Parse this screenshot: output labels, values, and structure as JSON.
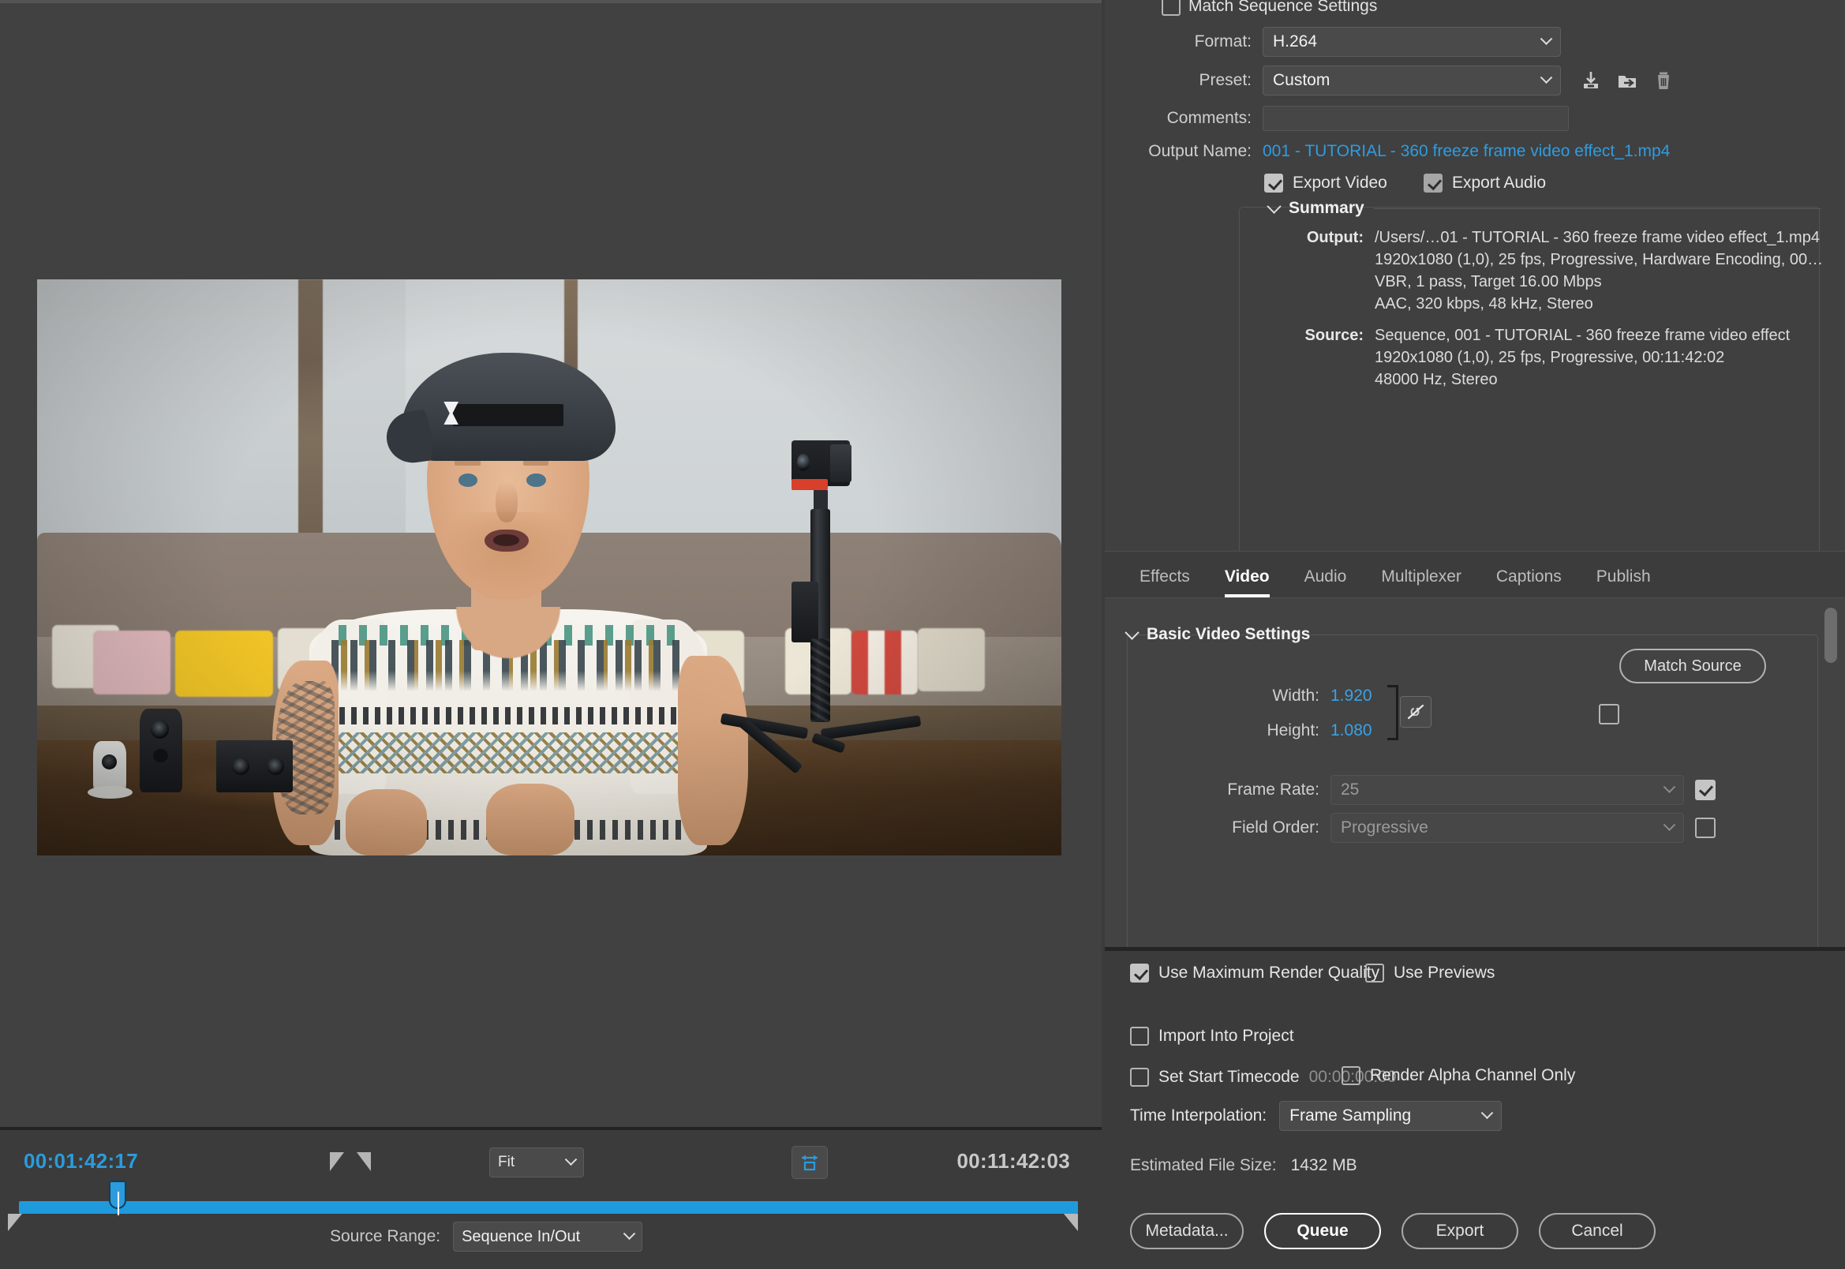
{
  "preview": {
    "current_timecode": "00:01:42:17",
    "duration_timecode": "00:11:42:03",
    "zoom_level": "Fit",
    "source_range_label": "Source Range:",
    "source_range_value": "Sequence In/Out"
  },
  "export_settings": {
    "match_sequence_settings": {
      "label": "Match Sequence Settings",
      "checked": false
    },
    "format": {
      "label": "Format:",
      "value": "H.264"
    },
    "preset": {
      "label": "Preset:",
      "value": "Custom"
    },
    "comments": {
      "label": "Comments:",
      "value": ""
    },
    "output_name": {
      "label": "Output Name:",
      "value": "001 - TUTORIAL - 360 freeze frame video effect_1.mp4"
    },
    "export_video": {
      "label": "Export Video",
      "checked": true
    },
    "export_audio": {
      "label": "Export Audio",
      "checked": true
    },
    "preset_icons": [
      "save-preset-icon",
      "import-preset-icon",
      "delete-preset-icon"
    ]
  },
  "summary": {
    "title": "Summary",
    "output_key": "Output:",
    "output_lines": [
      "/Users/…01 - TUTORIAL - 360 freeze frame video effect_1.mp4",
      "1920x1080 (1,0), 25 fps, Progressive, Hardware Encoding, 00…",
      "VBR, 1 pass, Target 16.00 Mbps",
      "AAC, 320 kbps, 48 kHz, Stereo"
    ],
    "source_key": "Source:",
    "source_lines": [
      "Sequence, 001 - TUTORIAL - 360 freeze frame video effect",
      "1920x1080 (1,0), 25 fps, Progressive, 00:11:42:02",
      "48000 Hz, Stereo"
    ]
  },
  "tabs": [
    {
      "label": "Effects",
      "active": false
    },
    {
      "label": "Video",
      "active": true
    },
    {
      "label": "Audio",
      "active": false
    },
    {
      "label": "Multiplexer",
      "active": false
    },
    {
      "label": "Captions",
      "active": false
    },
    {
      "label": "Publish",
      "active": false
    }
  ],
  "video_settings": {
    "group_title": "Basic Video Settings",
    "match_source_button": "Match Source",
    "width": {
      "label": "Width:",
      "value": "1.920"
    },
    "height": {
      "label": "Height:",
      "value": "1.080"
    },
    "link_icon": "broken-link-icon",
    "aspect_checkbox_checked": false,
    "frame_rate": {
      "label": "Frame Rate:",
      "value": "25",
      "checked": true
    },
    "field_order": {
      "label": "Field Order:",
      "value": "Progressive",
      "checked": false
    }
  },
  "bottom_options": {
    "use_max_render_quality": {
      "label": "Use Maximum Render Quality",
      "checked": true
    },
    "use_previews": {
      "label": "Use Previews",
      "checked": false
    },
    "import_into_project": {
      "label": "Import Into Project",
      "checked": false
    },
    "set_start_timecode": {
      "label": "Set Start Timecode",
      "checked": false,
      "value": "00:00:00:00"
    },
    "render_alpha_channel_only": {
      "label": "Render Alpha Channel Only",
      "checked": false
    },
    "time_interpolation": {
      "label": "Time Interpolation:",
      "value": "Frame Sampling"
    },
    "estimated_file_size": {
      "label": "Estimated File Size:",
      "value": "1432 MB"
    }
  },
  "actions": [
    {
      "label": "Metadata...",
      "primary": false
    },
    {
      "label": "Queue",
      "primary": true
    },
    {
      "label": "Export",
      "primary": false
    },
    {
      "label": "Cancel",
      "primary": false
    }
  ],
  "colors": {
    "accent_blue": "#2b9bdd",
    "link_blue": "#2f9ce0",
    "panel_bg": "#3b3b3b",
    "settings_bg": "#404040"
  }
}
